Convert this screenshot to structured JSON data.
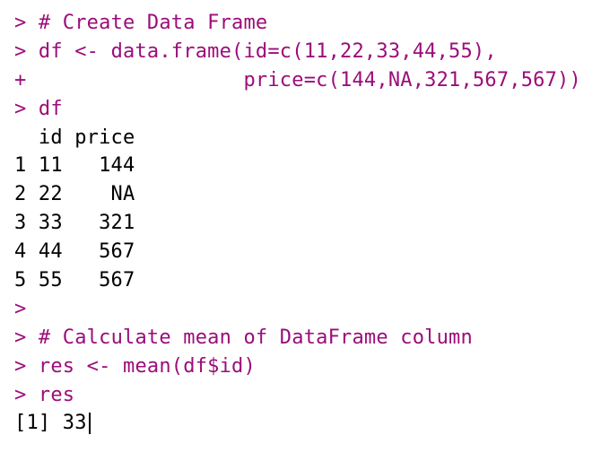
{
  "console": {
    "prompt": ">",
    "contprompt": "+",
    "lines": {
      "l1": "# Create Data Frame",
      "l2": "df <- data.frame(id=c(11,22,33,44,55),",
      "l3": "                 price=c(144,NA,321,567,567))",
      "l4": "df",
      "hdr": "  id price",
      "r1": "1 11   144",
      "r2": "2 22    NA",
      "r3": "3 33   321",
      "r4": "4 44   567",
      "r5": "5 55   567",
      "l5": "# Calculate mean of DataFrame column",
      "l6": "res <- mean(df$id)",
      "l7": "res",
      "l8": "[1] 33"
    }
  },
  "chart_data": {
    "type": "table",
    "title": "df",
    "columns": [
      "id",
      "price"
    ],
    "rows": [
      {
        "row": 1,
        "id": 11,
        "price": 144
      },
      {
        "row": 2,
        "id": 22,
        "price": null
      },
      {
        "row": 3,
        "id": 33,
        "price": 321
      },
      {
        "row": 4,
        "id": 44,
        "price": 567
      },
      {
        "row": 5,
        "id": 55,
        "price": 567
      }
    ],
    "mean_id": 33
  }
}
